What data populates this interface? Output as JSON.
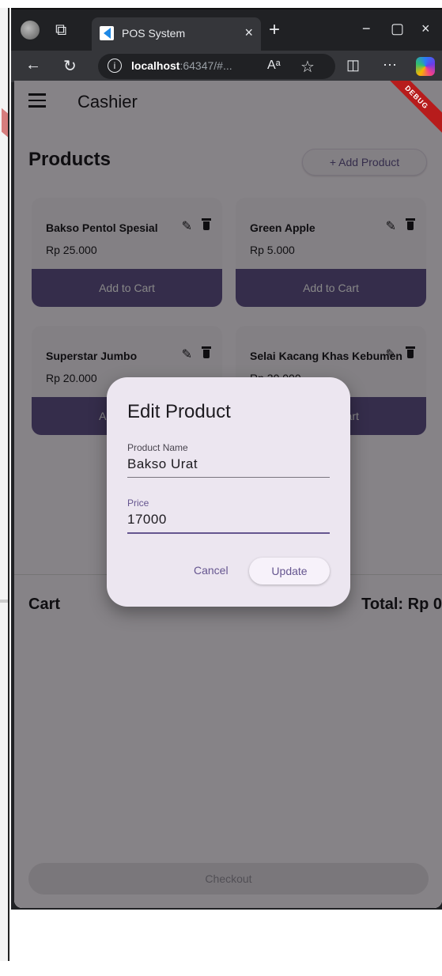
{
  "browser": {
    "tab_title": "POS System",
    "url_host": "localhost",
    "url_rest": ":64347/#...",
    "reader_label": "Aᵃ"
  },
  "app": {
    "title": "Cashier",
    "debug_label": "DEBUG",
    "products_heading": "Products",
    "add_product_label": "+ Add Product",
    "products": [
      {
        "name": "Bakso Pentol Spesial",
        "price": "Rp 25.000",
        "button": "Add to Cart"
      },
      {
        "name": "Green Apple",
        "price": "Rp 5.000",
        "button": "Add to Cart"
      },
      {
        "name": "Superstar Jumbo",
        "price": "Rp 20.000",
        "button": "Add to Cart"
      },
      {
        "name": "Selai Kacang Khas Kebumen",
        "price": "Rp 30.000",
        "button": "Add to Cart"
      }
    ],
    "cart_label": "Cart",
    "total_label": "Total: Rp 0",
    "checkout_label": "Checkout"
  },
  "dialog": {
    "title": "Edit Product",
    "name_label": "Product Name",
    "name_value": "Bakso Urat",
    "price_label": "Price",
    "price_value": "17000",
    "cancel_label": "Cancel",
    "update_label": "Update"
  },
  "colors": {
    "primary": "#65558f",
    "surface": "#fef7ff",
    "dialog": "#ece6f0",
    "debug": "#b71c1c"
  }
}
